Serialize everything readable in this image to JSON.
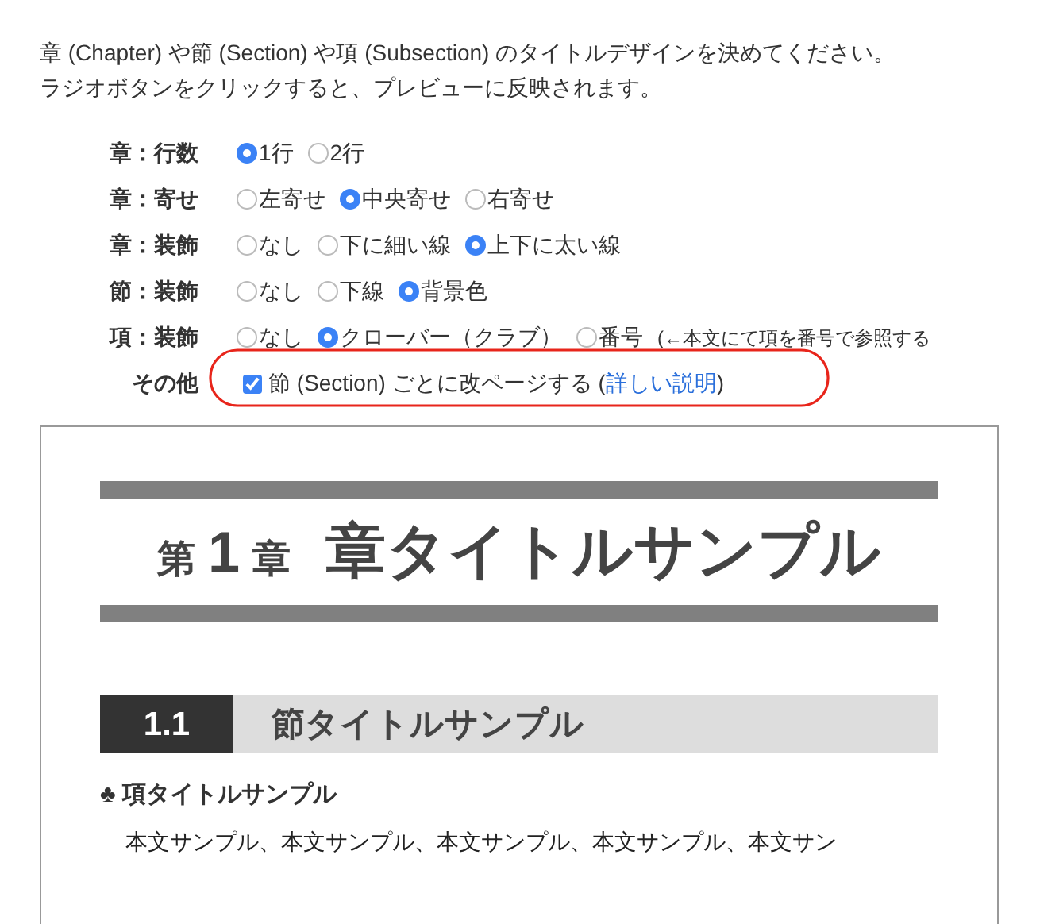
{
  "intro": [
    "章 (Chapter) や節 (Section) や項 (Subsection) のタイトルデザインを決めてください。",
    "ラジオボタンをクリックすると、プレビューに反映されます。"
  ],
  "options": [
    {
      "label": "章：行数",
      "kind": "radio",
      "choices": [
        {
          "label": "1行",
          "selected": true
        },
        {
          "label": "2行",
          "selected": false
        }
      ]
    },
    {
      "label": "章：寄せ",
      "kind": "radio",
      "choices": [
        {
          "label": "左寄せ",
          "selected": false
        },
        {
          "label": "中央寄せ",
          "selected": true
        },
        {
          "label": "右寄せ",
          "selected": false
        }
      ]
    },
    {
      "label": "章：装飾",
      "kind": "radio",
      "choices": [
        {
          "label": "なし",
          "selected": false
        },
        {
          "label": "下に細い線",
          "selected": false
        },
        {
          "label": "上下に太い線",
          "selected": true
        }
      ]
    },
    {
      "label": "節：装飾",
      "kind": "radio",
      "choices": [
        {
          "label": "なし",
          "selected": false
        },
        {
          "label": "下線",
          "selected": false
        },
        {
          "label": "背景色",
          "selected": true
        }
      ]
    },
    {
      "label": "項：装飾",
      "kind": "radio",
      "choices": [
        {
          "label": "なし",
          "selected": false
        },
        {
          "label": "クローバー（クラブ）",
          "selected": true
        },
        {
          "label": "番号",
          "selected": false
        }
      ],
      "note": "(←本文にて項を番号で参照する"
    },
    {
      "label": "その他",
      "kind": "checkbox",
      "checked": true,
      "text": "節 (Section) ごとに改ページする (",
      "link": "詳しい説明",
      "text_after": ")",
      "highlighted": true
    }
  ],
  "preview": {
    "chapter": {
      "prefix": "第",
      "number": "1",
      "suffix": "章",
      "title": "章タイトルサンプル"
    },
    "section": {
      "number": "1.1",
      "title": "節タイトルサンプル"
    },
    "subsection": {
      "mark": "♣",
      "title": "項タイトルサンプル"
    },
    "body": "本文サンプル、本文サンプル、本文サンプル、本文サンプル、本文サン"
  }
}
